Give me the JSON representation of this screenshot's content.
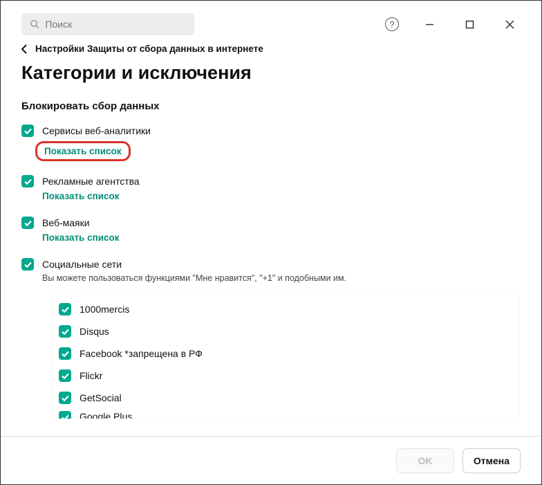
{
  "search": {
    "placeholder": "Поиск"
  },
  "breadcrumb": {
    "label": "Настройки Защиты от сбора данных в интернете"
  },
  "page_title": "Категории и исключения",
  "section_header": "Блокировать сбор данных",
  "show_list_label": "Показать список",
  "categories": [
    {
      "label": "Сервисы веб-аналитики",
      "highlight": true
    },
    {
      "label": "Рекламные агентства",
      "highlight": false
    },
    {
      "label": "Веб-маяки",
      "highlight": false
    },
    {
      "label": "Социальные сети",
      "highlight": false,
      "desc": "Вы можете пользоваться функциями \"Мне нравится\", \"+1\" и подобными им."
    }
  ],
  "sub_items": [
    {
      "label": "1000mercis"
    },
    {
      "label": "Disqus"
    },
    {
      "label": "Facebook *запрещена в РФ"
    },
    {
      "label": "Flickr"
    },
    {
      "label": "GetSocial"
    },
    {
      "label": "Google Plus"
    }
  ],
  "buttons": {
    "ok": "OK",
    "cancel": "Отмена"
  }
}
